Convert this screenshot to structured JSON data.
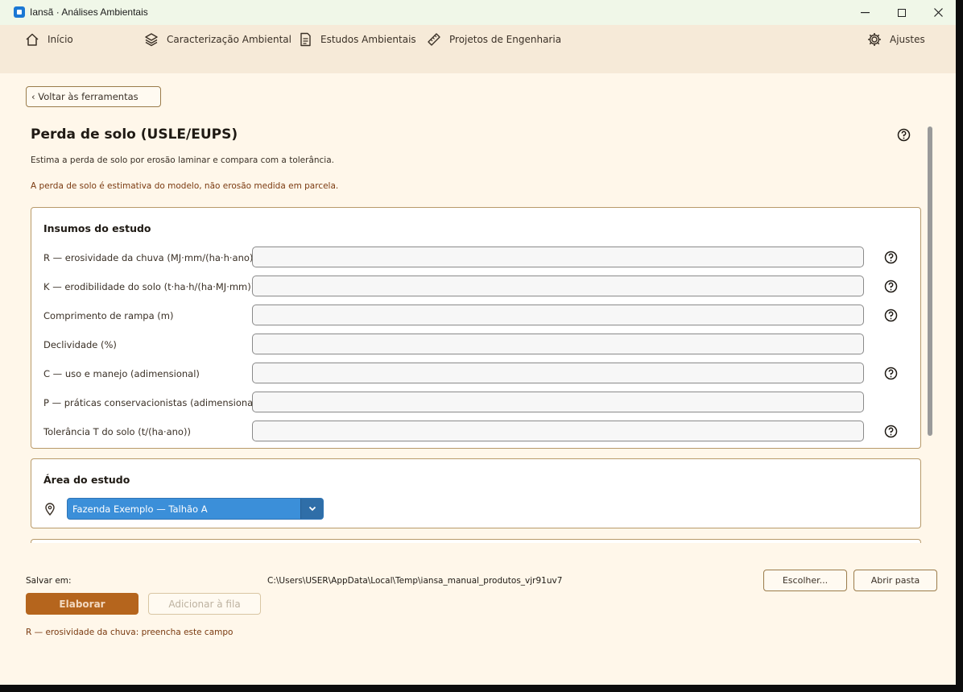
{
  "window": {
    "title": "Iansã · Análises Ambientais",
    "controls": {
      "minimize": "—",
      "maximize": "☐",
      "close": "✕"
    }
  },
  "nav": {
    "items": [
      {
        "label": "Início",
        "icon": "home-icon"
      },
      {
        "label": "Caracterização Ambiental",
        "icon": "layers-icon"
      },
      {
        "label": "Estudos Ambientais",
        "icon": "document-icon"
      },
      {
        "label": "Projetos de Engenharia",
        "icon": "ruler-icon"
      },
      {
        "label": "Ajustes",
        "icon": "gear-icon"
      }
    ]
  },
  "page": {
    "back_label": "‹ Voltar às ferramentas",
    "title": "Perda de solo (USLE/EUPS)",
    "subtitle": "Estima a perda de solo por erosão laminar e compara com a tolerância.",
    "warning": "A perda de solo é estimativa do modelo, não erosão medida em parcela."
  },
  "inputs": {
    "title": "Insumos do estudo",
    "fields": [
      {
        "label": "R — erosividade da chuva (MJ·mm/(ha·h·ano))",
        "value": "",
        "help": true
      },
      {
        "label": "K — erodibilidade do solo (t·ha·h/(ha·MJ·mm))",
        "value": "",
        "help": true
      },
      {
        "label": "Comprimento de rampa (m)",
        "value": "",
        "help": true
      },
      {
        "label": "Declividade (%)",
        "value": "",
        "help": false
      },
      {
        "label": "C — uso e manejo (adimensional)",
        "value": "",
        "help": true
      },
      {
        "label": "P — práticas conservacionistas (adimensional)",
        "value": "",
        "help": false
      },
      {
        "label": "Tolerância T do solo (t/(ha·ano))",
        "value": "",
        "help": true
      }
    ]
  },
  "area": {
    "title": "Área do estudo",
    "selected": "Fazenda Exemplo — Talhão A"
  },
  "footer": {
    "save_label": "Salvar em:",
    "save_path": "C:\\Users\\USER\\AppData\\Local\\Temp\\iansa_manual_produtos_vjr91uv7",
    "choose_label": "Escolher...",
    "open_folder_label": "Abrir pasta",
    "submit_label": "Elaborar",
    "queue_label": "Adicionar à fila",
    "error": "R — erosividade da chuva: preencha este campo"
  },
  "colors": {
    "accent": "#b5651d",
    "select": "#3b8fd9",
    "background": "#fff7ea",
    "warning_text": "#7a3a10"
  }
}
